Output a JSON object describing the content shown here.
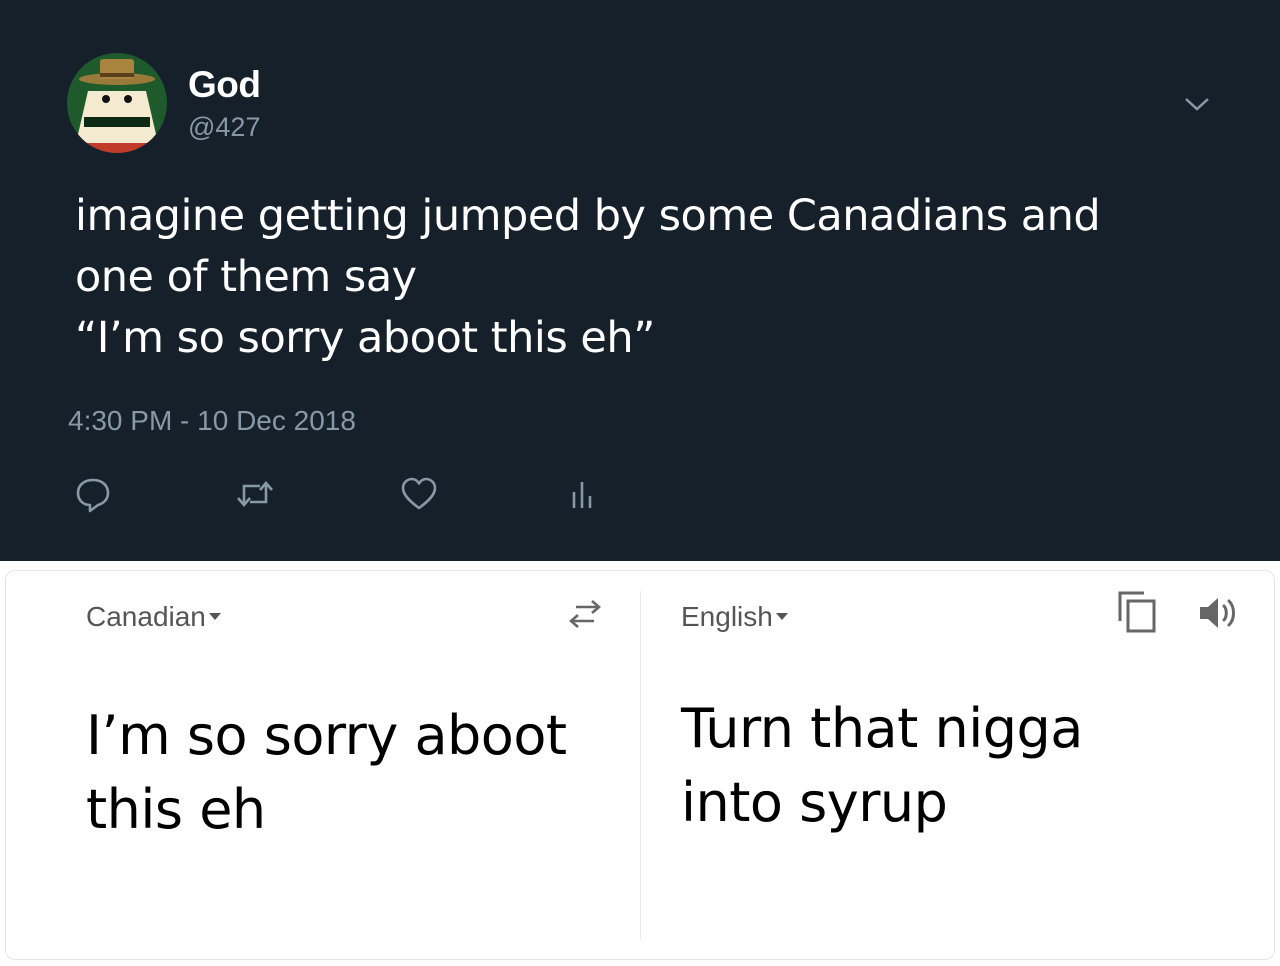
{
  "tweet": {
    "display_name": "God",
    "handle": "@427",
    "text_lines": [
      "imagine getting jumped by some Canadians and",
      "one of them say",
      "“I’m so sorry aboot this eh”"
    ],
    "timestamp": "4:30 PM - 10 Dec 2018",
    "icons": [
      "reply-icon",
      "retweet-icon",
      "like-icon",
      "analytics-icon",
      "chevron-down-icon"
    ]
  },
  "translator": {
    "source_language": "Canadian",
    "target_language": "English",
    "source_text_lines": [
      "I’m so sorry aboot",
      "this eh"
    ],
    "target_text_lines": [
      "Turn that nigga",
      "into syrup"
    ],
    "icons": [
      "swap-languages-icon",
      "copy-icon",
      "speaker-icon"
    ]
  },
  "colors": {
    "tweet_background": "#15202b",
    "secondary_text": "#8899a6",
    "translator_background": "#ffffff"
  }
}
